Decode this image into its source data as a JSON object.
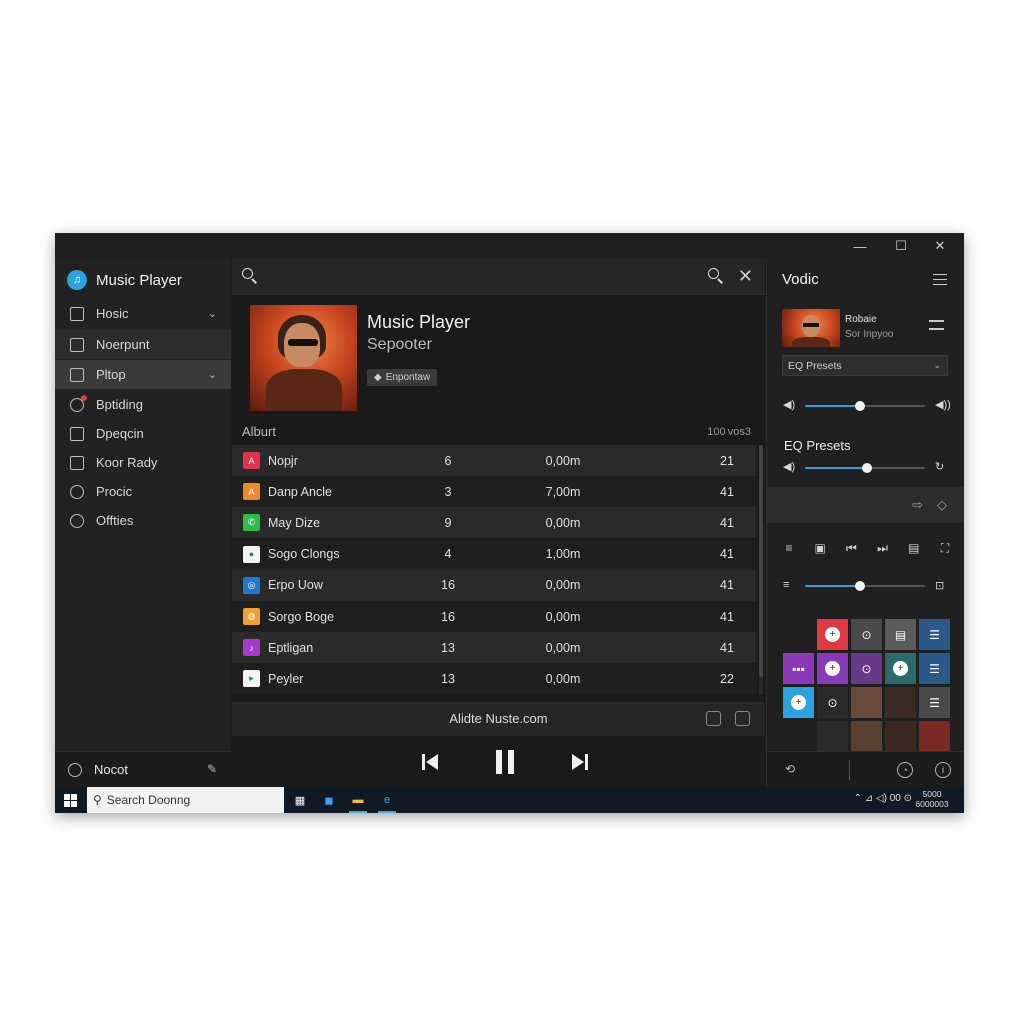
{
  "app": {
    "title": "Music Player"
  },
  "window_controls": {
    "minimize": "—",
    "maximize": "☐",
    "close": "✕"
  },
  "sidebar": {
    "items": [
      {
        "label": "Hosic",
        "icon": "folder-icon",
        "has_chevron": true
      },
      {
        "label": "Noerpunt",
        "icon": "grid-icon"
      },
      {
        "label": "Pltop",
        "icon": "list-icon",
        "has_chevron": true
      },
      {
        "label": "Bptiding",
        "icon": "sync-icon",
        "has_badge": true
      },
      {
        "label": "Dpeqcin",
        "icon": "tablet-icon"
      },
      {
        "label": "Koor Rady",
        "icon": "chat-icon"
      },
      {
        "label": "Procic",
        "icon": "globe-icon"
      },
      {
        "label": "Offties",
        "icon": "user-icon"
      }
    ],
    "footer": {
      "label": "Nocot",
      "icon": "grid-icon"
    },
    "chevron": "⌄"
  },
  "now_playing": {
    "title": "Music Player",
    "subtitle": "Sepooter",
    "tag": "Enpontaw"
  },
  "list": {
    "header": "Alburt",
    "count": "100 vos3",
    "tracks": [
      {
        "name": "Nopjr",
        "num": "6",
        "time": "0,00m",
        "last": "21",
        "color": "#e0334d",
        "glyph": "A"
      },
      {
        "name": "Danp Ancle",
        "num": "3",
        "time": "7,00m",
        "last": "41",
        "color": "#f08a24",
        "glyph": "A"
      },
      {
        "name": "May Dize",
        "num": "9",
        "time": "0,00m",
        "last": "41",
        "color": "#2bbd45",
        "glyph": "✆"
      },
      {
        "name": "Sogo Clongs",
        "num": "4",
        "time": "1,00m",
        "last": "41",
        "color": "#f4f4f4",
        "glyph": "●"
      },
      {
        "name": "Erpo Uow",
        "num": "16",
        "time": "0,00m",
        "last": "41",
        "color": "#1a7ad4",
        "glyph": "◎"
      },
      {
        "name": "Sorgo Boge",
        "num": "16",
        "time": "0,00m",
        "last": "41",
        "color": "#f0a030",
        "glyph": "◍"
      },
      {
        "name": "Eptligan",
        "num": "13",
        "time": "0,00m",
        "last": "41",
        "color": "#a63ad0",
        "glyph": "♪"
      },
      {
        "name": "Peyler",
        "num": "13",
        "time": "0,00m",
        "last": "22",
        "color": "#f4f4f4",
        "glyph": "▸"
      }
    ]
  },
  "strip": {
    "text": "Alidte Nuste.com"
  },
  "transport": {
    "prev": "prev-icon",
    "pause": "pause-icon",
    "next": "next-icon"
  },
  "right_panel": {
    "title": "Vodic",
    "track_name": "Robaie",
    "track_artist": "Sor Inpyoo",
    "select_value": "EQ Presets",
    "eq_label": "EQ Presets",
    "volume": 0.46,
    "eq_level": 0.52,
    "balance": 0.46,
    "accent": "#2aa3e0"
  },
  "taskbar": {
    "search": "Search Doonng",
    "tray": "⌃ ⊿ ◁) 00 ⊙",
    "clock_top": "5000",
    "clock_bottom": "6000003"
  }
}
